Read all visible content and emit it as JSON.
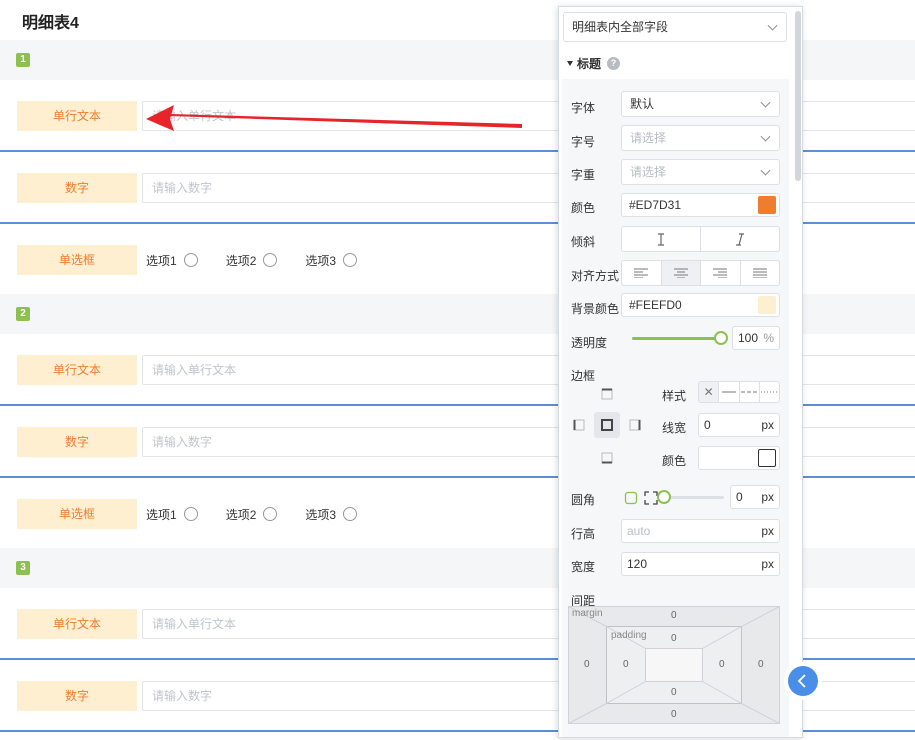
{
  "page": {
    "title": "明细表4"
  },
  "groups": [
    {
      "index": "1",
      "text_label": "单行文本",
      "text_placeholder": "请输入单行文本",
      "number_label": "数字",
      "number_placeholder": "请输入数字",
      "radio_label": "单选框",
      "radio_options": [
        "选项1",
        "选项2",
        "选项3"
      ]
    },
    {
      "index": "2",
      "text_label": "单行文本",
      "text_placeholder": "请输入单行文本",
      "number_label": "数字",
      "number_placeholder": "请输入数字",
      "radio_label": "单选框",
      "radio_options": [
        "选项1",
        "选项2",
        "选项3"
      ]
    },
    {
      "index": "3",
      "text_label": "单行文本",
      "text_placeholder": "请输入单行文本",
      "number_label": "数字",
      "number_placeholder": "请输入数字"
    }
  ],
  "panel": {
    "field_select": "明细表内全部字段",
    "section_title": "标题",
    "font": {
      "label": "字体",
      "value": "默认"
    },
    "size": {
      "label": "字号",
      "placeholder": "请选择"
    },
    "weight": {
      "label": "字重",
      "placeholder": "请选择"
    },
    "color": {
      "label": "颜色",
      "value": "#ED7D31"
    },
    "italic": {
      "label": "倾斜"
    },
    "align": {
      "label": "对齐方式",
      "active": "center"
    },
    "bg_color": {
      "label": "背景颜色",
      "value": "#FEEFD0"
    },
    "opacity": {
      "label": "透明度",
      "value": "100",
      "unit": "%",
      "fraction": 1.0
    },
    "border": {
      "label": "边框",
      "style_label": "样式",
      "width_label": "线宽",
      "width_value": "0",
      "width_unit": "px",
      "color_label": "颜色"
    },
    "radius": {
      "label": "圆角",
      "value": "0",
      "unit": "px",
      "fraction": 0.0
    },
    "line_height": {
      "label": "行高",
      "placeholder": "auto",
      "unit": "px"
    },
    "width": {
      "label": "宽度",
      "value": "120",
      "unit": "px"
    },
    "spacing": {
      "label": "间距",
      "margin_label": "margin",
      "padding_label": "padding",
      "margin": {
        "top": "0",
        "right": "0",
        "bottom": "0",
        "left": "0"
      },
      "padding": {
        "top": "0",
        "right": "0",
        "bottom": "0",
        "left": "0"
      }
    }
  },
  "colors": {
    "accent_green": "#8cc152",
    "label_bg": "#FEEFD0",
    "label_text": "#ED7D31",
    "divider_blue": "#5b8fd6",
    "arrow_red": "#e8242b",
    "collapse_blue": "#4a8fe7"
  },
  "icons": {
    "arrow": "red-arrow-annotation",
    "collapse": "chevron-left-icon",
    "help": "question-icon"
  }
}
